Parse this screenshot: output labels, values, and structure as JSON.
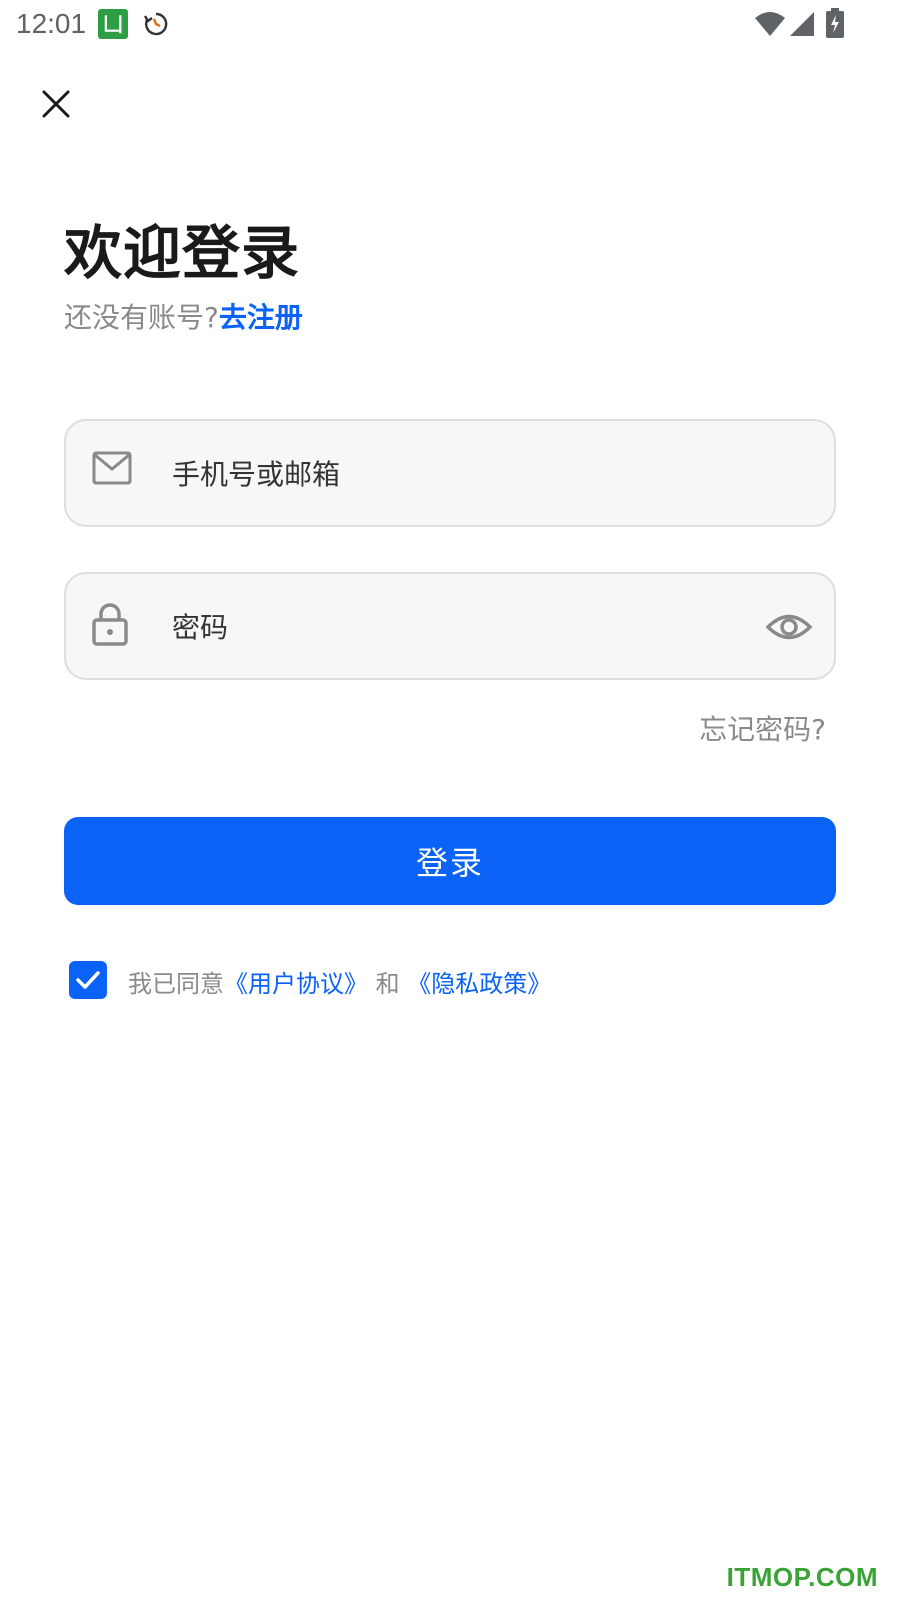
{
  "status_bar": {
    "time": "12:01",
    "app_icon_glyph": "凵",
    "icons": [
      "app-notification-icon",
      "sync-icon",
      "wifi-icon",
      "signal-icon",
      "battery-charging-icon"
    ]
  },
  "header": {
    "close_icon": "close-icon"
  },
  "login": {
    "title": "欢迎登录",
    "no_account_text": "还没有账号?",
    "register_link": "去注册",
    "phone_placeholder": "手机号或邮箱",
    "password_placeholder": "密码",
    "forgot_password": "忘记密码?",
    "login_button": "登录"
  },
  "agreement": {
    "checked": true,
    "prefix": "我已同意",
    "user_agreement": "《用户协议》",
    "and": " 和 ",
    "privacy_policy": "《隐私政策》"
  },
  "watermark": "ITMOP.COM",
  "colors": {
    "accent": "#0b62f7",
    "muted_text": "#8a8a8a",
    "input_bg": "#f7f7f7",
    "input_border": "#dedede",
    "watermark": "#3aa335"
  }
}
